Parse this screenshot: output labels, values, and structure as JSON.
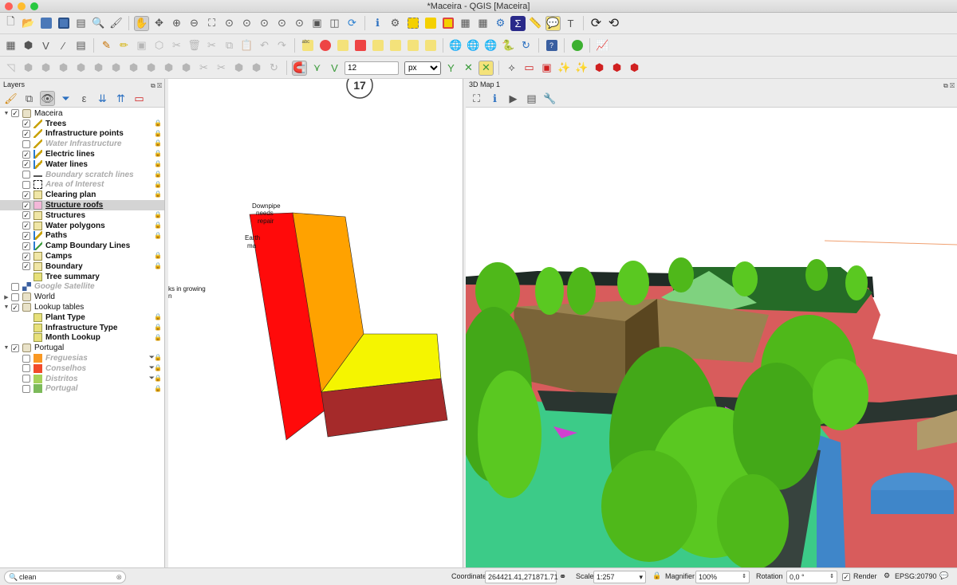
{
  "window": {
    "title": "*Maceira - QGIS [Maceira]"
  },
  "toolbar": {
    "snap_tolerance": "12",
    "snap_unit": "px"
  },
  "layers_panel": {
    "title": "Layers",
    "items": [
      {
        "label": "Maceira",
        "level": 0,
        "expanded": true,
        "checked": true,
        "style": "group",
        "symbol": "group"
      },
      {
        "label": "Trees",
        "level": 1,
        "checked": true,
        "style": "bold",
        "symbol": "line",
        "locked": true
      },
      {
        "label": "Infrastructure points",
        "level": 1,
        "checked": true,
        "style": "bold",
        "symbol": "line",
        "locked": true
      },
      {
        "label": "Water Infrastructure",
        "level": 1,
        "checked": false,
        "style": "off",
        "symbol": "line",
        "locked": true
      },
      {
        "label": "Electric lines",
        "level": 1,
        "checked": true,
        "style": "bold",
        "symbol": "vline",
        "locked": true
      },
      {
        "label": "Water lines",
        "level": 1,
        "checked": true,
        "style": "bold",
        "symbol": "vline",
        "locked": true
      },
      {
        "label": "Boundary scratch lines",
        "level": 1,
        "checked": false,
        "style": "off",
        "symbol": "dash",
        "locked": true
      },
      {
        "label": "Area of Interest",
        "level": 1,
        "checked": false,
        "style": "off",
        "symbol": "aoi",
        "locked": true
      },
      {
        "label": "Clearing plan",
        "level": 1,
        "checked": true,
        "style": "bold",
        "symbol": "poly",
        "locked": true
      },
      {
        "label": "Structure roofs",
        "level": 1,
        "checked": true,
        "style": "bold",
        "symbol": "pink",
        "selected": true,
        "underline": true
      },
      {
        "label": "Structures",
        "level": 1,
        "checked": true,
        "style": "bold",
        "symbol": "poly",
        "locked": true
      },
      {
        "label": "Water polygons",
        "level": 1,
        "checked": true,
        "style": "bold",
        "symbol": "poly",
        "locked": true
      },
      {
        "label": "Paths",
        "level": 1,
        "checked": true,
        "style": "bold",
        "symbol": "vline",
        "locked": true
      },
      {
        "label": "Camp Boundary Lines",
        "level": 1,
        "checked": true,
        "style": "bold",
        "symbol": "vline2",
        "locked": false
      },
      {
        "label": "Camps",
        "level": 1,
        "checked": true,
        "style": "bold",
        "symbol": "poly",
        "locked": true
      },
      {
        "label": "Boundary",
        "level": 1,
        "checked": true,
        "style": "bold",
        "symbol": "poly",
        "locked": true
      },
      {
        "label": "Tree summary",
        "level": 1,
        "checked": null,
        "style": "bold",
        "symbol": "table",
        "locked": false
      },
      {
        "label": "Google Satellite",
        "level": 0,
        "checked": false,
        "style": "off",
        "symbol": "raster",
        "locked": false
      },
      {
        "label": "World",
        "level": 0,
        "expanded": false,
        "checked": false,
        "style": "normal",
        "symbol": "group",
        "locked": false
      },
      {
        "label": "Lookup tables",
        "level": 0,
        "expanded": true,
        "checked": true,
        "style": "normal",
        "symbol": "group",
        "locked": false
      },
      {
        "label": "Plant Type",
        "level": 1,
        "checked": null,
        "style": "bold",
        "symbol": "table",
        "locked": true
      },
      {
        "label": "Infrastructure Type",
        "level": 1,
        "checked": null,
        "style": "bold",
        "symbol": "table",
        "locked": true
      },
      {
        "label": "Month Lookup",
        "level": 1,
        "checked": null,
        "style": "bold",
        "symbol": "table",
        "locked": true
      },
      {
        "label": "Portugal",
        "level": 0,
        "expanded": true,
        "checked": true,
        "style": "normal",
        "symbol": "group",
        "locked": false
      },
      {
        "label": "Freguesias",
        "level": 1,
        "checked": false,
        "style": "off",
        "symbol": "orange",
        "locked": true,
        "filtered": true
      },
      {
        "label": "Conselhos",
        "level": 1,
        "checked": false,
        "style": "off",
        "symbol": "red",
        "locked": true,
        "filtered": true
      },
      {
        "label": "Distritos",
        "level": 1,
        "checked": false,
        "style": "off",
        "symbol": "lime",
        "locked": true,
        "filtered": true
      },
      {
        "label": "Portugal",
        "level": 1,
        "checked": false,
        "style": "off",
        "symbol": "green",
        "locked": true
      }
    ]
  },
  "map_canvas": {
    "badge": "17",
    "annotations": {
      "downpipe_1": "Downpipe",
      "downpipe_2": "needs",
      "downpipe_3": "repair",
      "earth_1": "Earth",
      "earth_2": "ma",
      "growing_1": "ks in growing",
      "growing_2": "n"
    }
  },
  "map3d_panel": {
    "title": "3D Map 1"
  },
  "status_bar": {
    "search_value": "clean",
    "coordinate_label": "Coordinate",
    "coordinate_value": "264421.41,271871.71",
    "scale_label": "Scale",
    "scale_value": "1:257",
    "magnifier_label": "Magnifier",
    "magnifier_value": "100%",
    "rotation_label": "Rotation",
    "rotation_value": "0,0 °",
    "render_label": "Render",
    "crs": "EPSG:20790"
  },
  "colors": {
    "roof_red": "#ff0a0a",
    "roof_orange": "#ffa200",
    "roof_yellow": "#f5f500",
    "roof_darkred": "#a52a2a",
    "grass": "#3ccb88",
    "tree_green": "#4fb81a",
    "water_blue": "#3f86c9"
  }
}
